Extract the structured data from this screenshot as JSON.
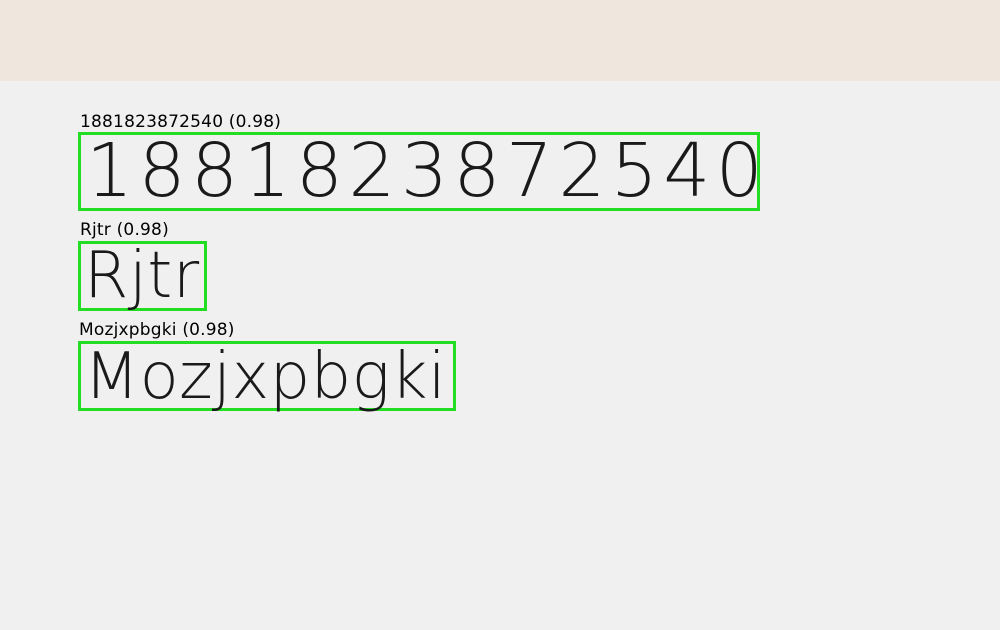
{
  "detections": [
    {
      "label": "1881823872540 (0.98)",
      "text": "1881823872540"
    },
    {
      "label": "Rjtr (0.98)",
      "text": "Rjtr"
    },
    {
      "label": "Mozjxpbgki (0.98)",
      "text": "Mozjxpbgki"
    }
  ],
  "colors": {
    "top_band": "#efe7de",
    "canvas": "#f0f0f0",
    "box_outline": "#22dd22",
    "text": "#1a1a1a"
  }
}
